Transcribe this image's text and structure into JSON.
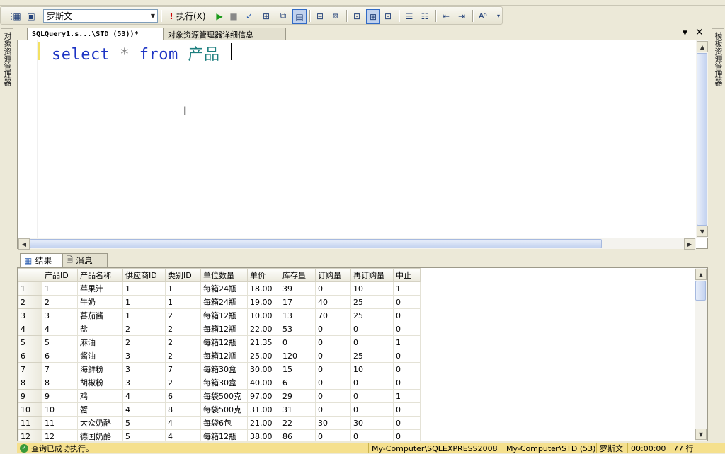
{
  "toolbar": {
    "database": "罗斯文",
    "execute_label": "执行(X)"
  },
  "side_panels": {
    "left": "对象资源管理器",
    "right": "模板资源管理器"
  },
  "doc_tabs": [
    {
      "label": "SQLQuery1.s...\\STD (53))*"
    },
    {
      "label": "对象资源管理器详细信息"
    }
  ],
  "editor": {
    "keyword_select": "select",
    "op_star": "*",
    "keyword_from": "from",
    "table_name": "产品"
  },
  "results_tabs": {
    "results": "结果",
    "messages": "消息"
  },
  "grid": {
    "columns": [
      "产品ID",
      "产品名称",
      "供应商ID",
      "类别ID",
      "单位数量",
      "单价",
      "库存量",
      "订购量",
      "再订购量",
      "中止"
    ],
    "rows": [
      [
        "1",
        "1",
        "苹果汁",
        "1",
        "1",
        "每箱24瓶",
        "18.00",
        "39",
        "0",
        "10",
        "1"
      ],
      [
        "2",
        "2",
        "牛奶",
        "1",
        "1",
        "每箱24瓶",
        "19.00",
        "17",
        "40",
        "25",
        "0"
      ],
      [
        "3",
        "3",
        "蕃茄酱",
        "1",
        "2",
        "每箱12瓶",
        "10.00",
        "13",
        "70",
        "25",
        "0"
      ],
      [
        "4",
        "4",
        "盐",
        "2",
        "2",
        "每箱12瓶",
        "22.00",
        "53",
        "0",
        "0",
        "0"
      ],
      [
        "5",
        "5",
        "麻油",
        "2",
        "2",
        "每箱12瓶",
        "21.35",
        "0",
        "0",
        "0",
        "1"
      ],
      [
        "6",
        "6",
        "酱油",
        "3",
        "2",
        "每箱12瓶",
        "25.00",
        "120",
        "0",
        "25",
        "0"
      ],
      [
        "7",
        "7",
        "海鲜粉",
        "3",
        "7",
        "每箱30盒",
        "30.00",
        "15",
        "0",
        "10",
        "0"
      ],
      [
        "8",
        "8",
        "胡椒粉",
        "3",
        "2",
        "每箱30盒",
        "40.00",
        "6",
        "0",
        "0",
        "0"
      ],
      [
        "9",
        "9",
        "鸡",
        "4",
        "6",
        "每袋500克",
        "97.00",
        "29",
        "0",
        "0",
        "1"
      ],
      [
        "10",
        "10",
        "蟹",
        "4",
        "8",
        "每袋500克",
        "31.00",
        "31",
        "0",
        "0",
        "0"
      ],
      [
        "11",
        "11",
        "大众奶酪",
        "5",
        "4",
        "每袋6包",
        "21.00",
        "22",
        "30",
        "30",
        "0"
      ],
      [
        "12",
        "12",
        "德国奶酪",
        "5",
        "4",
        "每箱12瓶",
        "38.00",
        "86",
        "0",
        "0",
        "0"
      ]
    ]
  },
  "statusbar": {
    "message": "查询已成功执行。",
    "server": "My-Computer\\SQLEXPRESS2008",
    "connection": "My-Computer\\STD (53)",
    "database": "罗斯文",
    "elapsed": "00:00:00",
    "rows": "77 行"
  }
}
